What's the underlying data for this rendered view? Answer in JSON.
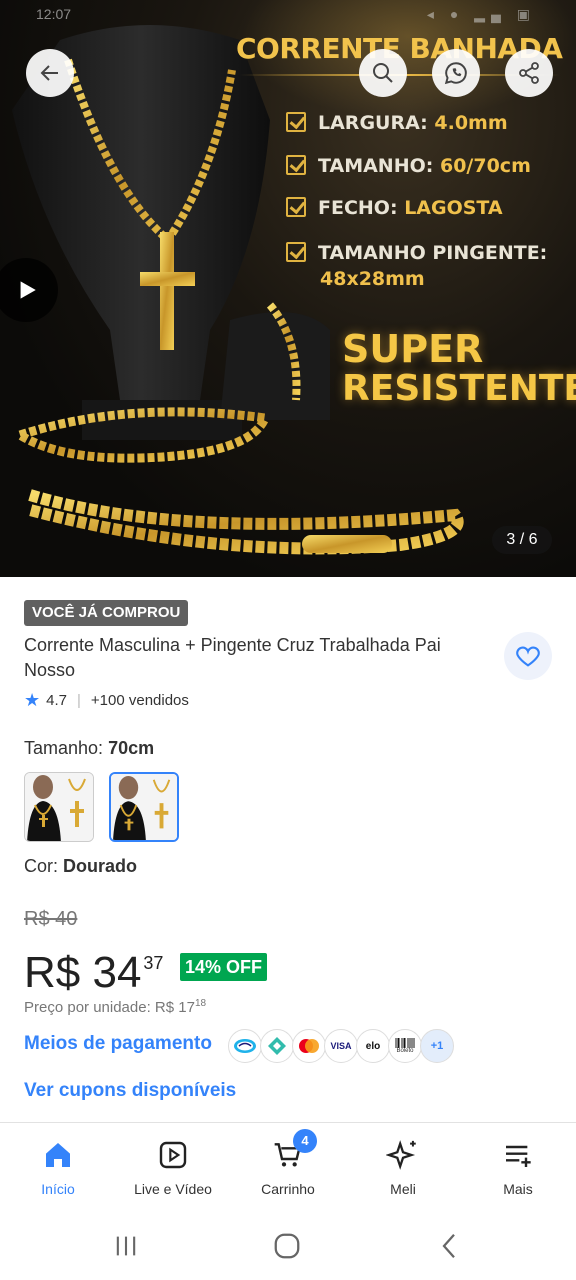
{
  "status_bar": {
    "time": "12:07"
  },
  "hero": {
    "headline": "CORRENTE BANHADA",
    "specs": [
      {
        "key": "LARGURA:",
        "value": "4.0mm"
      },
      {
        "key": "TAMANHO:",
        "value": "60/70cm"
      },
      {
        "key": "FECHO:",
        "value": "LAGOSTA"
      },
      {
        "key": "TAMANHO PINGENTE:",
        "value": "48x28mm"
      }
    ],
    "promo_line1": "SUPER",
    "promo_line2": "RESISTENTE",
    "page_indicator": "3 / 6"
  },
  "product": {
    "tag": "VOCÊ JÁ COMPROU",
    "title": "Corrente Masculina + Pingente Cruz Trabalhada Pai Nosso",
    "rating": "4.7",
    "sold": "+100 vendidos",
    "size_label": "Tamanho:",
    "size_value": "70cm",
    "color_label": "Cor:",
    "color_value": "Dourado",
    "old_price": "R$ 40",
    "price_main": "R$ 34",
    "price_cents": "37",
    "discount": "14% OFF",
    "unit_price_label": "Preço por unidade: R$ 17",
    "unit_price_cents": "18",
    "payment_link": "Meios de pagamento",
    "payment_icons": [
      "mercado-pago",
      "pix",
      "mastercard",
      "VISA",
      "elo",
      "Boleto"
    ],
    "payment_more": "+1",
    "coupons_link": "Ver cupons disponíveis"
  },
  "bottom_nav": {
    "items": [
      {
        "label": "Início",
        "icon": "home-icon"
      },
      {
        "label": "Live e Vídeo",
        "icon": "play-square-icon"
      },
      {
        "label": "Carrinho",
        "icon": "cart-icon"
      },
      {
        "label": "Meli",
        "icon": "sparkle-icon"
      },
      {
        "label": "Mais",
        "icon": "menu-plus-icon"
      }
    ],
    "cart_count": "4"
  },
  "colors": {
    "accent": "#3483fa",
    "discount_green": "#00a650",
    "gold": "#f0c04c"
  }
}
